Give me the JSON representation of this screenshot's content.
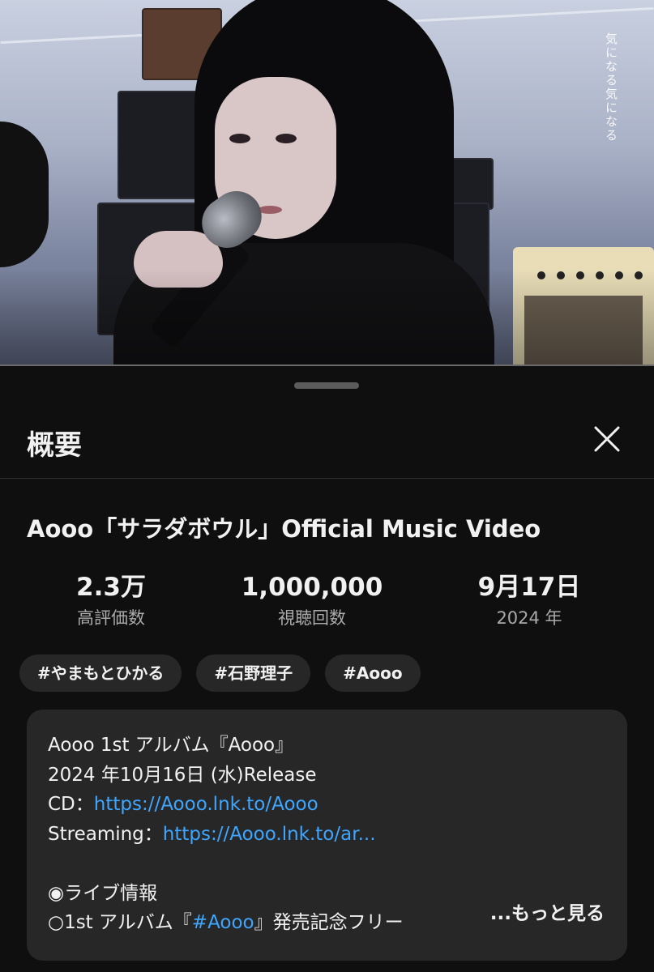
{
  "video": {
    "overlay_text": "気になる気になる"
  },
  "sheet": {
    "title": "概要",
    "video_title": "Aooo「サラダボウル」Official Music Video",
    "stats": [
      {
        "value": "2.3万",
        "label": "高評価数"
      },
      {
        "value": "1,000,000",
        "label": "視聴回数"
      },
      {
        "value": "9月17日",
        "label": "2024 年"
      }
    ],
    "tags": [
      "#やまもとひかる",
      "#石野理子",
      "#Aooo"
    ],
    "description": {
      "line1": "Aooo 1st アルバム『Aooo』",
      "line2": "2024 年10月16日 (水)Release",
      "line3_label": "CD：",
      "line3_link": "https://Aooo.lnk.to/Aooo",
      "line4_label": "Streaming：",
      "line4_link": "https://Aooo.lnk.to/ar...",
      "line6": "◉ライブ情報",
      "line7_prefix": "○1st アルバム『",
      "line7_link": "#Aooo",
      "line7_suffix": "』発売記念フリー",
      "more_label": "...もっと見る"
    }
  },
  "colors": {
    "background": "#0f0f0f",
    "surface": "#272727",
    "link": "#3ea6ff",
    "text": "#f1f1f1",
    "secondary_text": "#aaaaaa"
  }
}
